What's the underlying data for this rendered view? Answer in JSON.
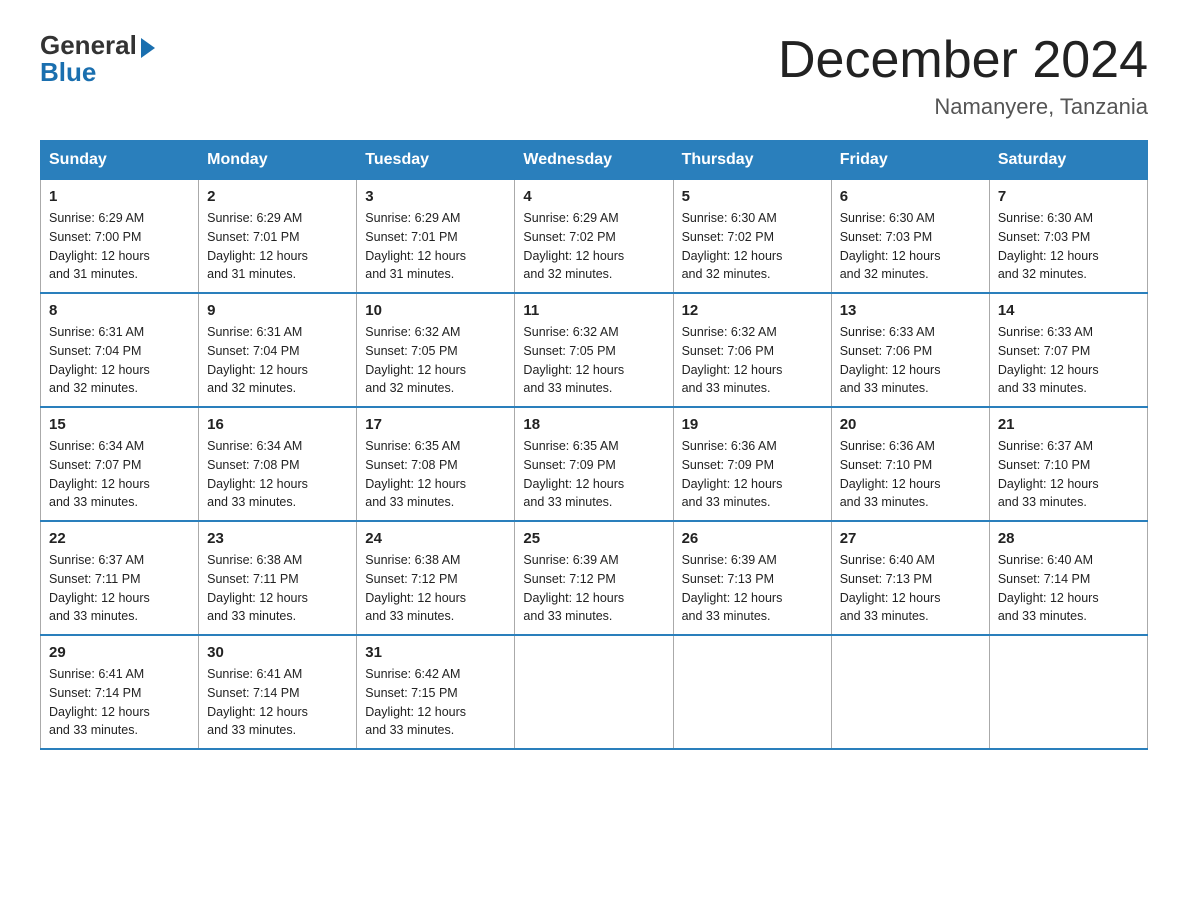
{
  "logo": {
    "general": "General",
    "blue": "Blue"
  },
  "title": "December 2024",
  "location": "Namanyere, Tanzania",
  "days_of_week": [
    "Sunday",
    "Monday",
    "Tuesday",
    "Wednesday",
    "Thursday",
    "Friday",
    "Saturday"
  ],
  "weeks": [
    [
      {
        "day": "1",
        "sunrise": "6:29 AM",
        "sunset": "7:00 PM",
        "daylight": "12 hours and 31 minutes."
      },
      {
        "day": "2",
        "sunrise": "6:29 AM",
        "sunset": "7:01 PM",
        "daylight": "12 hours and 31 minutes."
      },
      {
        "day": "3",
        "sunrise": "6:29 AM",
        "sunset": "7:01 PM",
        "daylight": "12 hours and 31 minutes."
      },
      {
        "day": "4",
        "sunrise": "6:29 AM",
        "sunset": "7:02 PM",
        "daylight": "12 hours and 32 minutes."
      },
      {
        "day": "5",
        "sunrise": "6:30 AM",
        "sunset": "7:02 PM",
        "daylight": "12 hours and 32 minutes."
      },
      {
        "day": "6",
        "sunrise": "6:30 AM",
        "sunset": "7:03 PM",
        "daylight": "12 hours and 32 minutes."
      },
      {
        "day": "7",
        "sunrise": "6:30 AM",
        "sunset": "7:03 PM",
        "daylight": "12 hours and 32 minutes."
      }
    ],
    [
      {
        "day": "8",
        "sunrise": "6:31 AM",
        "sunset": "7:04 PM",
        "daylight": "12 hours and 32 minutes."
      },
      {
        "day": "9",
        "sunrise": "6:31 AM",
        "sunset": "7:04 PM",
        "daylight": "12 hours and 32 minutes."
      },
      {
        "day": "10",
        "sunrise": "6:32 AM",
        "sunset": "7:05 PM",
        "daylight": "12 hours and 32 minutes."
      },
      {
        "day": "11",
        "sunrise": "6:32 AM",
        "sunset": "7:05 PM",
        "daylight": "12 hours and 33 minutes."
      },
      {
        "day": "12",
        "sunrise": "6:32 AM",
        "sunset": "7:06 PM",
        "daylight": "12 hours and 33 minutes."
      },
      {
        "day": "13",
        "sunrise": "6:33 AM",
        "sunset": "7:06 PM",
        "daylight": "12 hours and 33 minutes."
      },
      {
        "day": "14",
        "sunrise": "6:33 AM",
        "sunset": "7:07 PM",
        "daylight": "12 hours and 33 minutes."
      }
    ],
    [
      {
        "day": "15",
        "sunrise": "6:34 AM",
        "sunset": "7:07 PM",
        "daylight": "12 hours and 33 minutes."
      },
      {
        "day": "16",
        "sunrise": "6:34 AM",
        "sunset": "7:08 PM",
        "daylight": "12 hours and 33 minutes."
      },
      {
        "day": "17",
        "sunrise": "6:35 AM",
        "sunset": "7:08 PM",
        "daylight": "12 hours and 33 minutes."
      },
      {
        "day": "18",
        "sunrise": "6:35 AM",
        "sunset": "7:09 PM",
        "daylight": "12 hours and 33 minutes."
      },
      {
        "day": "19",
        "sunrise": "6:36 AM",
        "sunset": "7:09 PM",
        "daylight": "12 hours and 33 minutes."
      },
      {
        "day": "20",
        "sunrise": "6:36 AM",
        "sunset": "7:10 PM",
        "daylight": "12 hours and 33 minutes."
      },
      {
        "day": "21",
        "sunrise": "6:37 AM",
        "sunset": "7:10 PM",
        "daylight": "12 hours and 33 minutes."
      }
    ],
    [
      {
        "day": "22",
        "sunrise": "6:37 AM",
        "sunset": "7:11 PM",
        "daylight": "12 hours and 33 minutes."
      },
      {
        "day": "23",
        "sunrise": "6:38 AM",
        "sunset": "7:11 PM",
        "daylight": "12 hours and 33 minutes."
      },
      {
        "day": "24",
        "sunrise": "6:38 AM",
        "sunset": "7:12 PM",
        "daylight": "12 hours and 33 minutes."
      },
      {
        "day": "25",
        "sunrise": "6:39 AM",
        "sunset": "7:12 PM",
        "daylight": "12 hours and 33 minutes."
      },
      {
        "day": "26",
        "sunrise": "6:39 AM",
        "sunset": "7:13 PM",
        "daylight": "12 hours and 33 minutes."
      },
      {
        "day": "27",
        "sunrise": "6:40 AM",
        "sunset": "7:13 PM",
        "daylight": "12 hours and 33 minutes."
      },
      {
        "day": "28",
        "sunrise": "6:40 AM",
        "sunset": "7:14 PM",
        "daylight": "12 hours and 33 minutes."
      }
    ],
    [
      {
        "day": "29",
        "sunrise": "6:41 AM",
        "sunset": "7:14 PM",
        "daylight": "12 hours and 33 minutes."
      },
      {
        "day": "30",
        "sunrise": "6:41 AM",
        "sunset": "7:14 PM",
        "daylight": "12 hours and 33 minutes."
      },
      {
        "day": "31",
        "sunrise": "6:42 AM",
        "sunset": "7:15 PM",
        "daylight": "12 hours and 33 minutes."
      },
      null,
      null,
      null,
      null
    ]
  ],
  "labels": {
    "sunrise": "Sunrise:",
    "sunset": "Sunset:",
    "daylight": "Daylight:"
  }
}
